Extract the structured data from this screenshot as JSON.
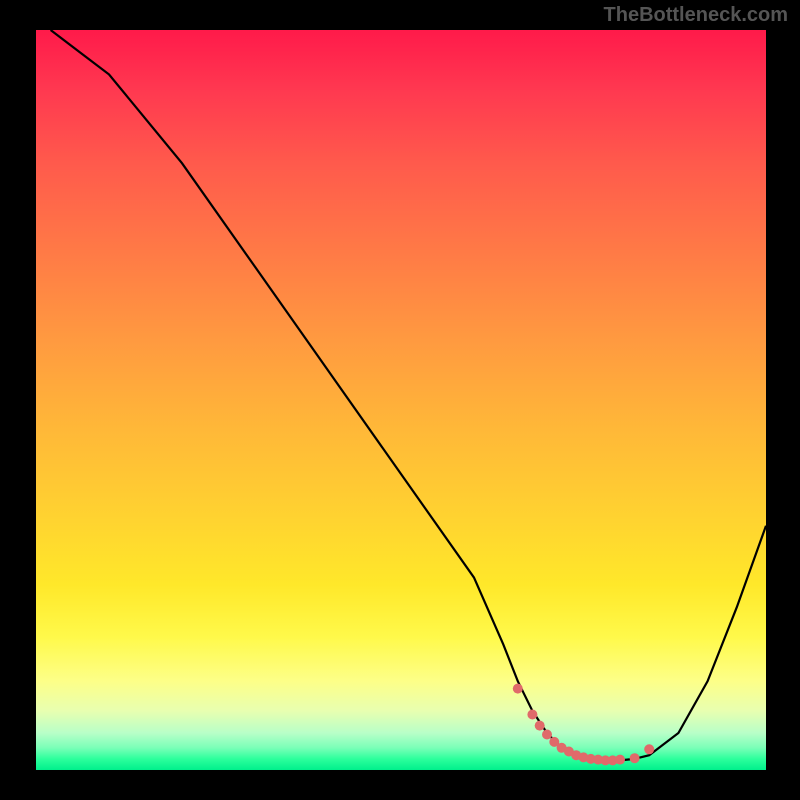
{
  "watermark": "TheBottleneck.com",
  "chart_data": {
    "type": "line",
    "title": "",
    "xlabel": "",
    "ylabel": "",
    "xlim": [
      0,
      100
    ],
    "ylim": [
      0,
      100
    ],
    "series": [
      {
        "name": "bottleneck-curve",
        "x": [
          2,
          6,
          10,
          20,
          30,
          40,
          50,
          60,
          64,
          66,
          68,
          70,
          72,
          74,
          76,
          78,
          80,
          82,
          84,
          88,
          92,
          96,
          100
        ],
        "y": [
          100,
          97,
          94,
          82,
          68,
          54,
          40,
          26,
          17,
          12,
          8,
          5,
          3,
          2,
          1.5,
          1.3,
          1.3,
          1.5,
          2,
          5,
          12,
          22,
          33
        ]
      }
    ],
    "markers": {
      "name": "highlight-dots",
      "x": [
        66,
        68,
        69,
        70,
        71,
        72,
        73,
        74,
        75,
        76,
        77,
        78,
        79,
        80,
        82,
        84
      ],
      "y": [
        11,
        7.5,
        6,
        4.8,
        3.8,
        3.0,
        2.5,
        2.0,
        1.7,
        1.5,
        1.4,
        1.3,
        1.3,
        1.4,
        1.6,
        2.8
      ]
    },
    "gradient_stops": [
      {
        "pct": 0,
        "color": "#ff1a4a"
      },
      {
        "pct": 18,
        "color": "#ff5a4c"
      },
      {
        "pct": 42,
        "color": "#ff9a40"
      },
      {
        "pct": 66,
        "color": "#ffd330"
      },
      {
        "pct": 82,
        "color": "#fff94a"
      },
      {
        "pct": 95,
        "color": "#b8ffc8"
      },
      {
        "pct": 100,
        "color": "#00f08c"
      }
    ],
    "marker_color": "#e06a6a",
    "curve_color": "#000000"
  }
}
